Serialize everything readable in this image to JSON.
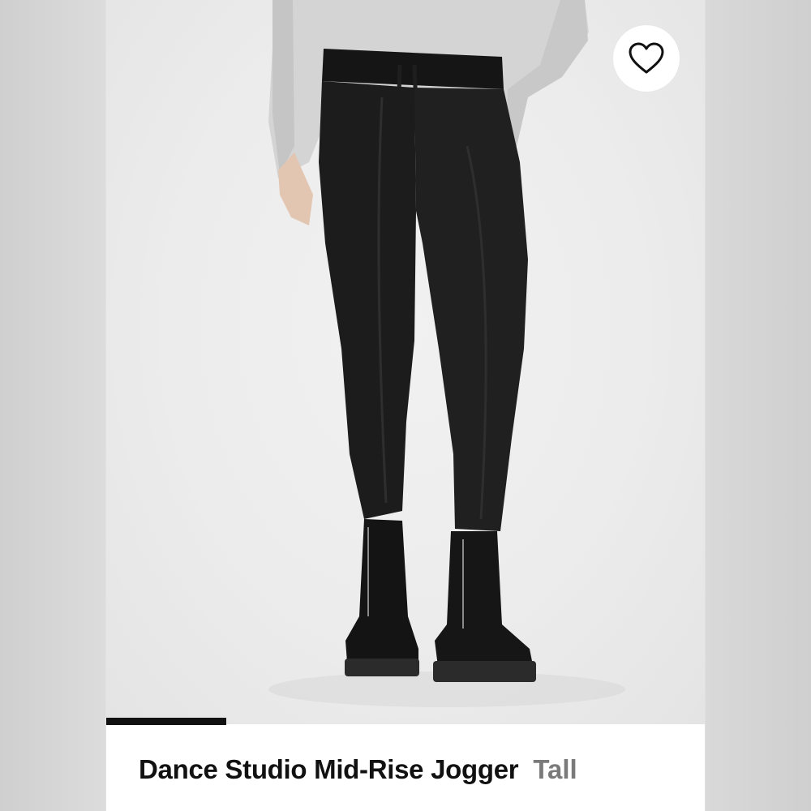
{
  "product": {
    "title": "Dance Studio Mid-Rise Jogger",
    "variant": "Tall",
    "image_subject": "black jogger pants with grey sweatshirt and black boots"
  },
  "gallery": {
    "progress_fraction": 0.2
  },
  "favorite": {
    "icon": "heart-outline-icon"
  },
  "colors": {
    "title": "#111111",
    "variant": "#7a7a7a",
    "background": "#ececec",
    "progress": "#111111"
  }
}
